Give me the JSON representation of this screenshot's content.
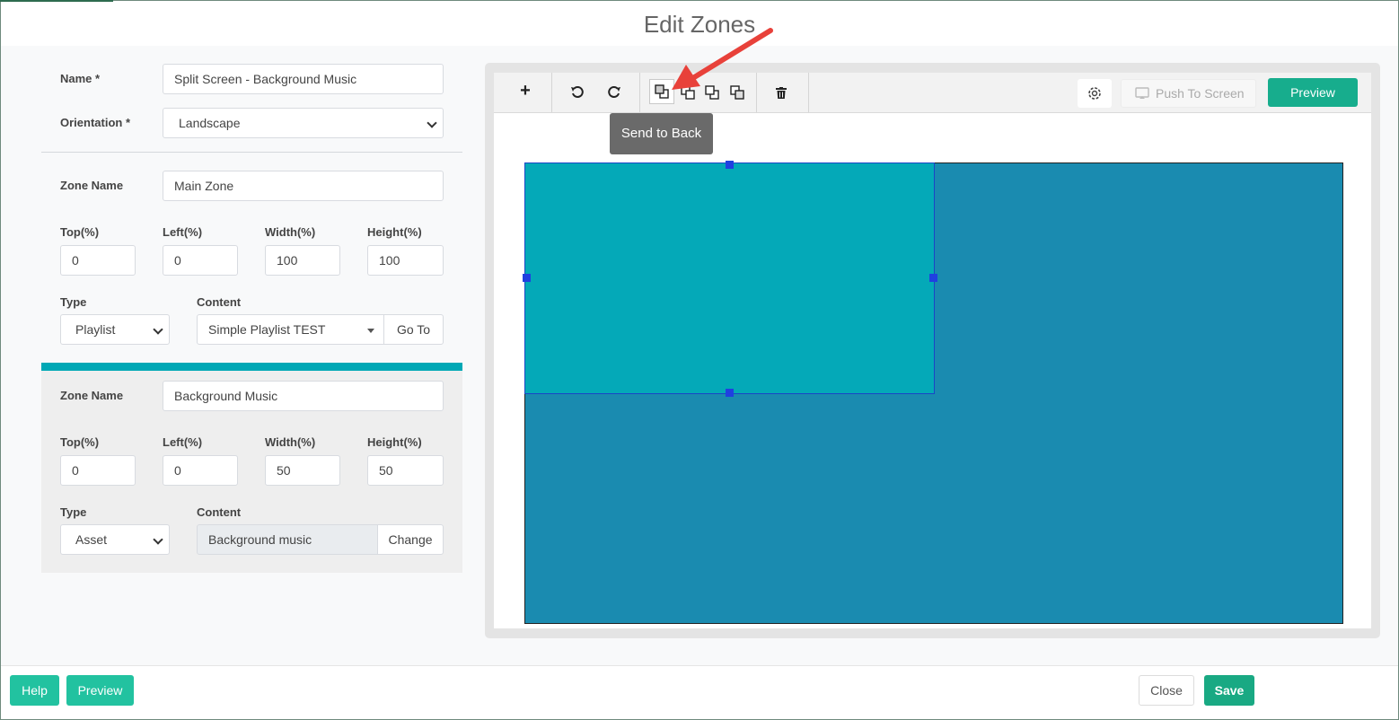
{
  "title": "Edit Zones",
  "form": {
    "name_label": "Name *",
    "name_value": "Split Screen - Background Music",
    "orientation_label": "Orientation *",
    "orientation_value": "Landscape"
  },
  "zones": [
    {
      "zone_name_label": "Zone Name",
      "zone_name": "Main Zone",
      "top_label": "Top(%)",
      "left_label": "Left(%)",
      "width_label": "Width(%)",
      "height_label": "Height(%)",
      "top": "0",
      "left": "0",
      "width": "100",
      "height": "100",
      "type_label": "Type",
      "type": "Playlist",
      "content_label": "Content",
      "content": "Simple Playlist TEST",
      "action": "Go To"
    },
    {
      "zone_name_label": "Zone Name",
      "zone_name": "Background Music",
      "top_label": "Top(%)",
      "left_label": "Left(%)",
      "width_label": "Width(%)",
      "height_label": "Height(%)",
      "top": "0",
      "left": "0",
      "width": "50",
      "height": "50",
      "type_label": "Type",
      "type": "Asset",
      "content_label": "Content",
      "content": "Background music",
      "action": "Change"
    }
  ],
  "toolbar": {
    "add": "+",
    "tooltip": "Send to Back",
    "push_to_screen": "Push To Screen",
    "preview": "Preview"
  },
  "colors": {
    "accent_teal": "#00a8b5",
    "screen_bg": "#1a8bb0",
    "zone_selected": "#04a9b8",
    "button_green": "#19a983"
  },
  "footer": {
    "help": "Help",
    "preview": "Preview",
    "close": "Close",
    "save": "Save"
  }
}
